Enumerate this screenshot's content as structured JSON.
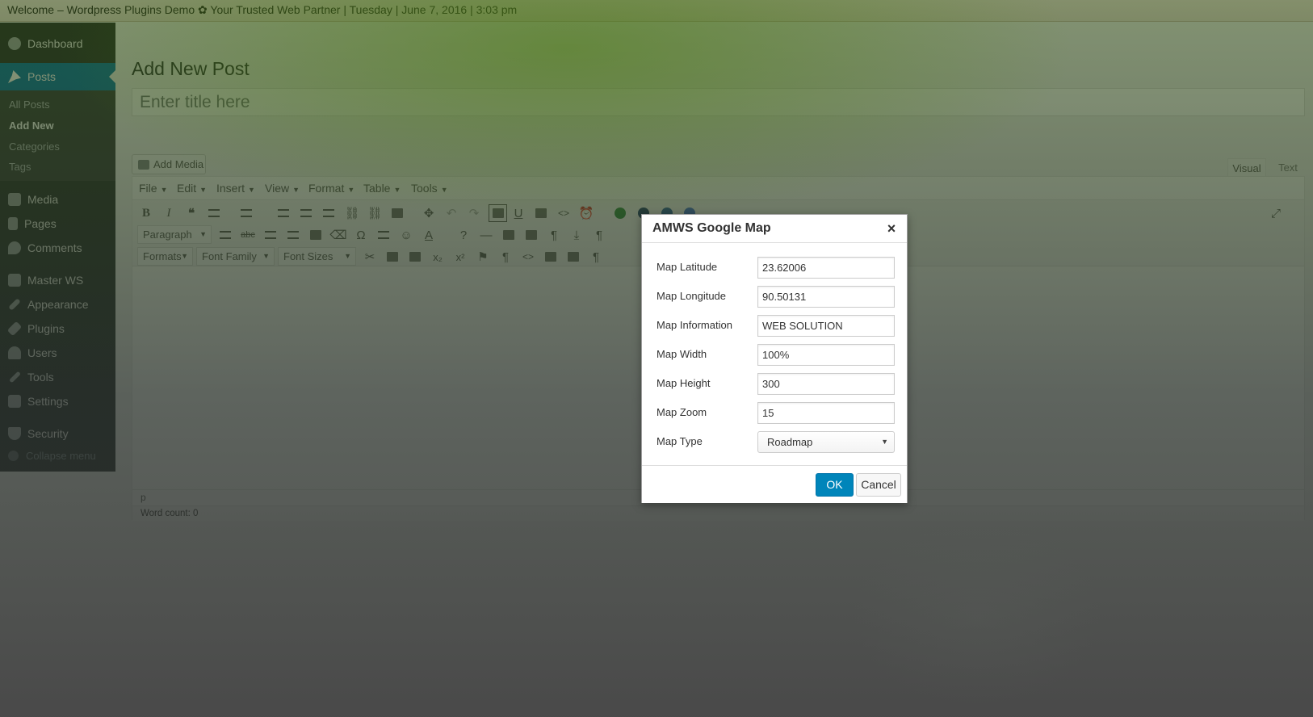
{
  "topbar": {
    "text": "Welcome – Wordpress Plugins Demo ✿ Your Trusted Web Partner  | Tuesday | June 7, 2016 | 3:03 pm"
  },
  "sidebar": {
    "items": [
      {
        "label": "Dashboard",
        "icon": "dashboard-icon"
      },
      {
        "label": "Posts",
        "icon": "pin-icon"
      },
      {
        "label": "Media",
        "icon": "media-icon"
      },
      {
        "label": "Pages",
        "icon": "pages-icon"
      },
      {
        "label": "Comments",
        "icon": "comments-icon"
      },
      {
        "label": "Master WS",
        "icon": "master-ws-icon"
      },
      {
        "label": "Appearance",
        "icon": "appearance-icon"
      },
      {
        "label": "Plugins",
        "icon": "plugins-icon"
      },
      {
        "label": "Users",
        "icon": "users-icon"
      },
      {
        "label": "Tools",
        "icon": "tools-icon"
      },
      {
        "label": "Settings",
        "icon": "settings-icon"
      },
      {
        "label": "Security",
        "icon": "shield-icon"
      }
    ],
    "submenu": [
      "All Posts",
      "Add New",
      "Categories",
      "Tags"
    ],
    "collapse": "Collapse menu"
  },
  "page": {
    "title": "Add New Post",
    "title_placeholder": "Enter title here",
    "add_media": "Add Media",
    "tab_visual": "Visual",
    "tab_text": "Text"
  },
  "editor": {
    "menus": [
      "File",
      "Edit",
      "Insert",
      "View",
      "Format",
      "Table",
      "Tools"
    ],
    "paragraph_select": "Paragraph",
    "formats_select": "Formats",
    "font_family_select": "Font Family",
    "font_sizes_select": "Font Sizes",
    "path": "p",
    "word_count": "Word count: 0"
  },
  "modal": {
    "title": "AMWS Google Map",
    "close": "×",
    "fields": [
      {
        "label": "Map Latitude",
        "value": "23.62006"
      },
      {
        "label": "Map Longitude",
        "value": "90.50131"
      },
      {
        "label": "Map Information",
        "value": "WEB SOLUTION"
      },
      {
        "label": "Map Width",
        "value": "100%"
      },
      {
        "label": "Map Height",
        "value": "300"
      },
      {
        "label": "Map Zoom",
        "value": "15"
      }
    ],
    "map_type_label": "Map Type",
    "map_type_value": "Roadmap",
    "ok": "OK",
    "cancel": "Cancel"
  },
  "colors": {
    "accent": "#0073aa",
    "ok_button": "#0085ba",
    "menu_bg": "#23282d"
  }
}
